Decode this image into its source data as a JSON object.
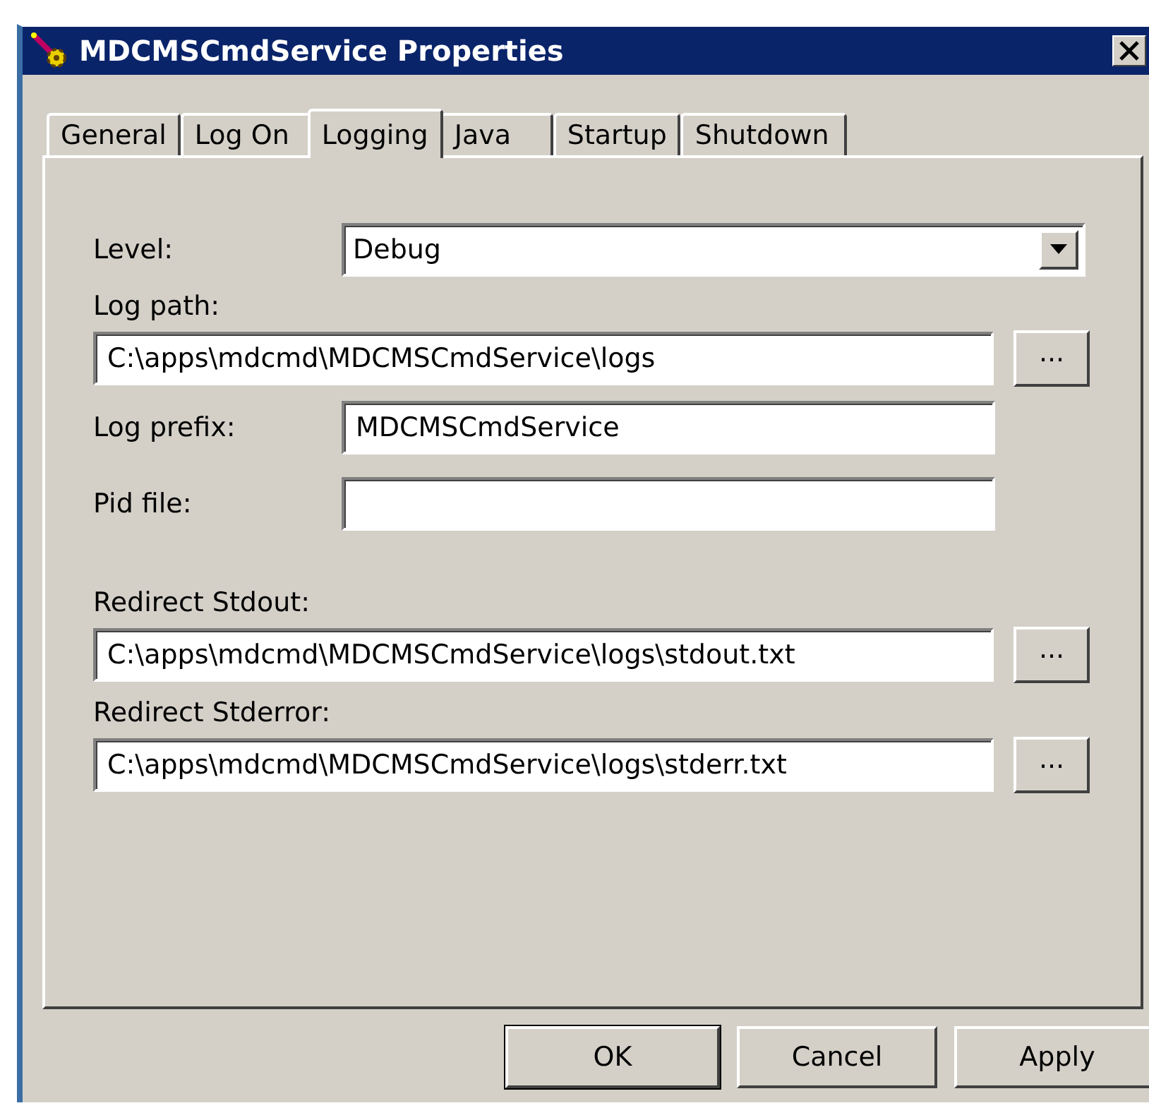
{
  "window": {
    "title": "MDCMSCmdService Properties"
  },
  "tabs": [
    {
      "label": "General",
      "selected": false
    },
    {
      "label": "Log On",
      "selected": false
    },
    {
      "label": "Logging",
      "selected": true
    },
    {
      "label": "Java",
      "selected": false
    },
    {
      "label": "Startup",
      "selected": false
    },
    {
      "label": "Shutdown",
      "selected": false
    }
  ],
  "fields": [
    {
      "kind": "combo",
      "label": "Level:",
      "value": "Debug"
    },
    {
      "kind": "path",
      "label": "Log path:",
      "value": "C:\\apps\\mdcmd\\MDCMSCmdService\\logs",
      "browse": "..."
    },
    {
      "kind": "inline",
      "label": "Log prefix:",
      "value": "MDCMSCmdService"
    },
    {
      "kind": "inline",
      "label": "Pid file:"
    },
    {
      "kind": "path",
      "label": "Redirect Stdout:",
      "value": "C:\\apps\\mdcmd\\MDCMSCmdService\\logs\\stdout.txt",
      "browse": "..."
    },
    {
      "kind": "path",
      "label": "Redirect Stderror:",
      "value": "C:\\apps\\mdcmd\\MDCMSCmdService\\logs\\stderr.txt",
      "browse": "..."
    }
  ],
  "buttons": [
    {
      "label": "OK",
      "default": true
    },
    {
      "label": "Cancel",
      "default": false
    },
    {
      "label": "Apply",
      "default": false
    }
  ]
}
